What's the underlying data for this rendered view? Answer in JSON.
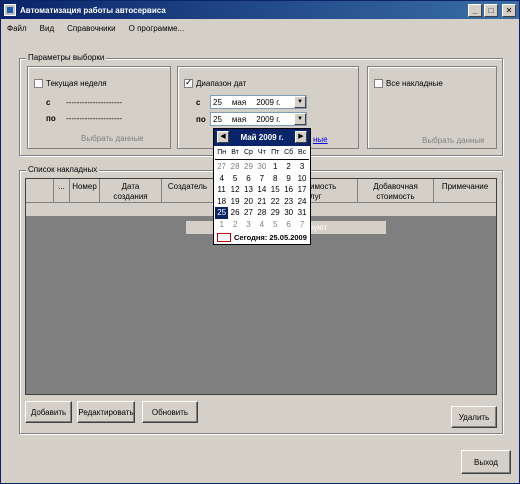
{
  "window": {
    "title": "Автоматизация работы автосервиса",
    "minimize": "_",
    "maximize": "□",
    "close": "✕"
  },
  "menu": [
    "Файл",
    "Вид",
    "Справочники",
    "О программе..."
  ],
  "selection": {
    "title": "Параметры выборки",
    "current_week": {
      "label": "Текущая неделя",
      "checked": false,
      "from_label": "с",
      "to_label": "по",
      "from_value": "---------------------",
      "to_value": "---------------------",
      "action": "Выбрать данные"
    },
    "date_range": {
      "label": "Диапазон дат",
      "checked": true,
      "from_label": "с",
      "to_label": "по",
      "from": {
        "day": "25",
        "month": "мая",
        "year": "2009 г."
      },
      "to": {
        "day": "25",
        "month": "мая",
        "year": "2009 г."
      },
      "action_partial": "ные"
    },
    "all_invoices": {
      "label": "Все накладные",
      "checked": false,
      "action": "Выбрать данные"
    }
  },
  "invoices": {
    "title": "Список накладных",
    "columns": [
      "...",
      "Номер",
      "Дата создания",
      "Создатель",
      "Стоимость услуг",
      "Добавочная стоимость",
      "Примечание"
    ],
    "visible_columns": [
      "",
      "...",
      "Номер",
      "Дата\nсоздания",
      "Создатель",
      "",
      "тоимость\nуслуг",
      "Добавочная\nстоимость",
      "Примечание"
    ],
    "empty_message_partial": "Данные п                     отсутствуют"
  },
  "buttons": {
    "add": "Добавить",
    "edit": "Редактировать",
    "refresh": "Обновить",
    "delete": "Удалить",
    "exit": "Выход"
  },
  "calendar": {
    "month_title": "Май 2009 г.",
    "weekdays": [
      "Пн",
      "Вт",
      "Ср",
      "Чт",
      "Пт",
      "Сб",
      "Вс"
    ],
    "weeks": [
      [
        "27",
        "28",
        "29",
        "30",
        "1",
        "2",
        "3"
      ],
      [
        "4",
        "5",
        "6",
        "7",
        "8",
        "9",
        "10"
      ],
      [
        "11",
        "12",
        "13",
        "14",
        "15",
        "16",
        "17"
      ],
      [
        "18",
        "19",
        "20",
        "21",
        "22",
        "23",
        "24"
      ],
      [
        "25",
        "26",
        "27",
        "28",
        "29",
        "30",
        "31"
      ],
      [
        "1",
        "2",
        "3",
        "4",
        "5",
        "6",
        "7"
      ]
    ],
    "selected_day": "25",
    "today_label": "Сегодня: 25.05.2009"
  }
}
